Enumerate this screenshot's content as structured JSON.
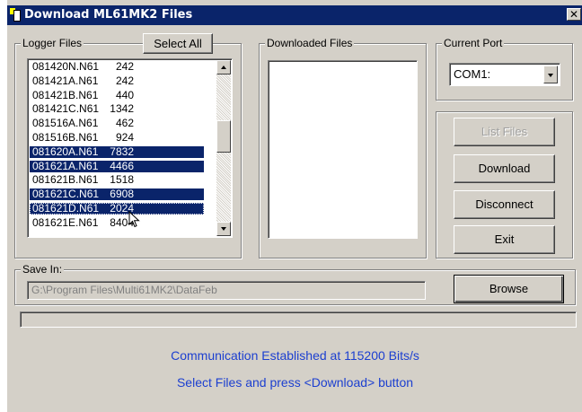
{
  "window": {
    "title": "Download ML61MK2 Files",
    "close_symbol": "✕"
  },
  "logger_files": {
    "label": "Logger Files",
    "select_all_label": "Select All",
    "scroll_position": 0.4,
    "files": [
      {
        "name": "081420N.N61",
        "size": "242",
        "selected": false
      },
      {
        "name": "081421A.N61",
        "size": "242",
        "selected": false
      },
      {
        "name": "081421B.N61",
        "size": "440",
        "selected": false
      },
      {
        "name": "081421C.N61",
        "size": "1342",
        "selected": false
      },
      {
        "name": "081516A.N61",
        "size": "462",
        "selected": false
      },
      {
        "name": "081516B.N61",
        "size": "924",
        "selected": false
      },
      {
        "name": "081620A.N61",
        "size": "7832",
        "selected": true
      },
      {
        "name": "081621A.N61",
        "size": "4466",
        "selected": true
      },
      {
        "name": "081621B.N61",
        "size": "1518",
        "selected": false
      },
      {
        "name": "081621C.N61",
        "size": "6908",
        "selected": true
      },
      {
        "name": "081621D.N61",
        "size": "2024",
        "selected": true
      },
      {
        "name": "081621E.N61",
        "size": "8404",
        "selected": false
      }
    ]
  },
  "downloaded_files": {
    "label": "Downloaded Files",
    "files": []
  },
  "current_port": {
    "label": "Current Port",
    "value": "COM1:"
  },
  "actions": {
    "list_files": "List Files",
    "download": "Download",
    "disconnect": "Disconnect",
    "exit": "Exit"
  },
  "save_in": {
    "label": "Save In:",
    "path": "G:\\Program Files\\Multi61MK2\\DataFeb",
    "browse_label": "Browse"
  },
  "progress": {
    "value": 0
  },
  "status": {
    "line1": "Communication Established at 115200 Bits/s",
    "line2": "Select Files and press <Download> button"
  },
  "colors": {
    "title_bar": "#0a246a",
    "selection": "#0a246a",
    "status_text": "#1c3fd0",
    "face": "#d4d0c8"
  }
}
